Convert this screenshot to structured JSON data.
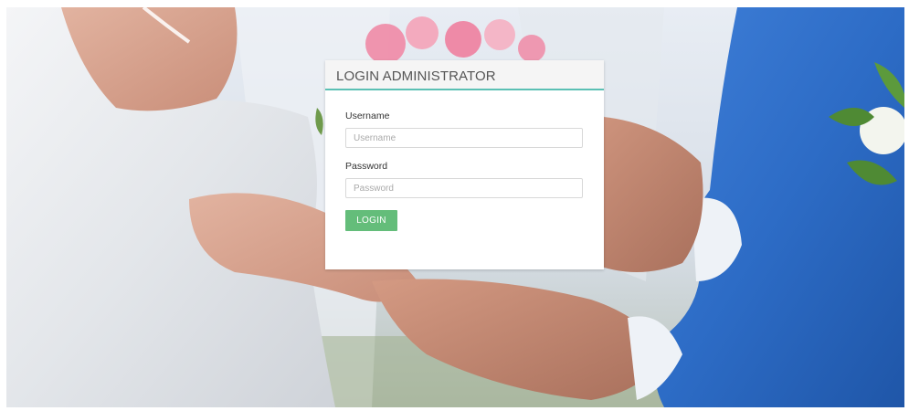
{
  "login": {
    "title": "LOGIN ADMINISTRATOR",
    "username_label": "Username",
    "username_placeholder": "Username",
    "username_value": "",
    "password_label": "Password",
    "password_placeholder": "Password",
    "password_value": "",
    "login_button": "LOGIN"
  },
  "colors": {
    "accent_border": "#5bc0b4",
    "button": "#64bd7a"
  }
}
